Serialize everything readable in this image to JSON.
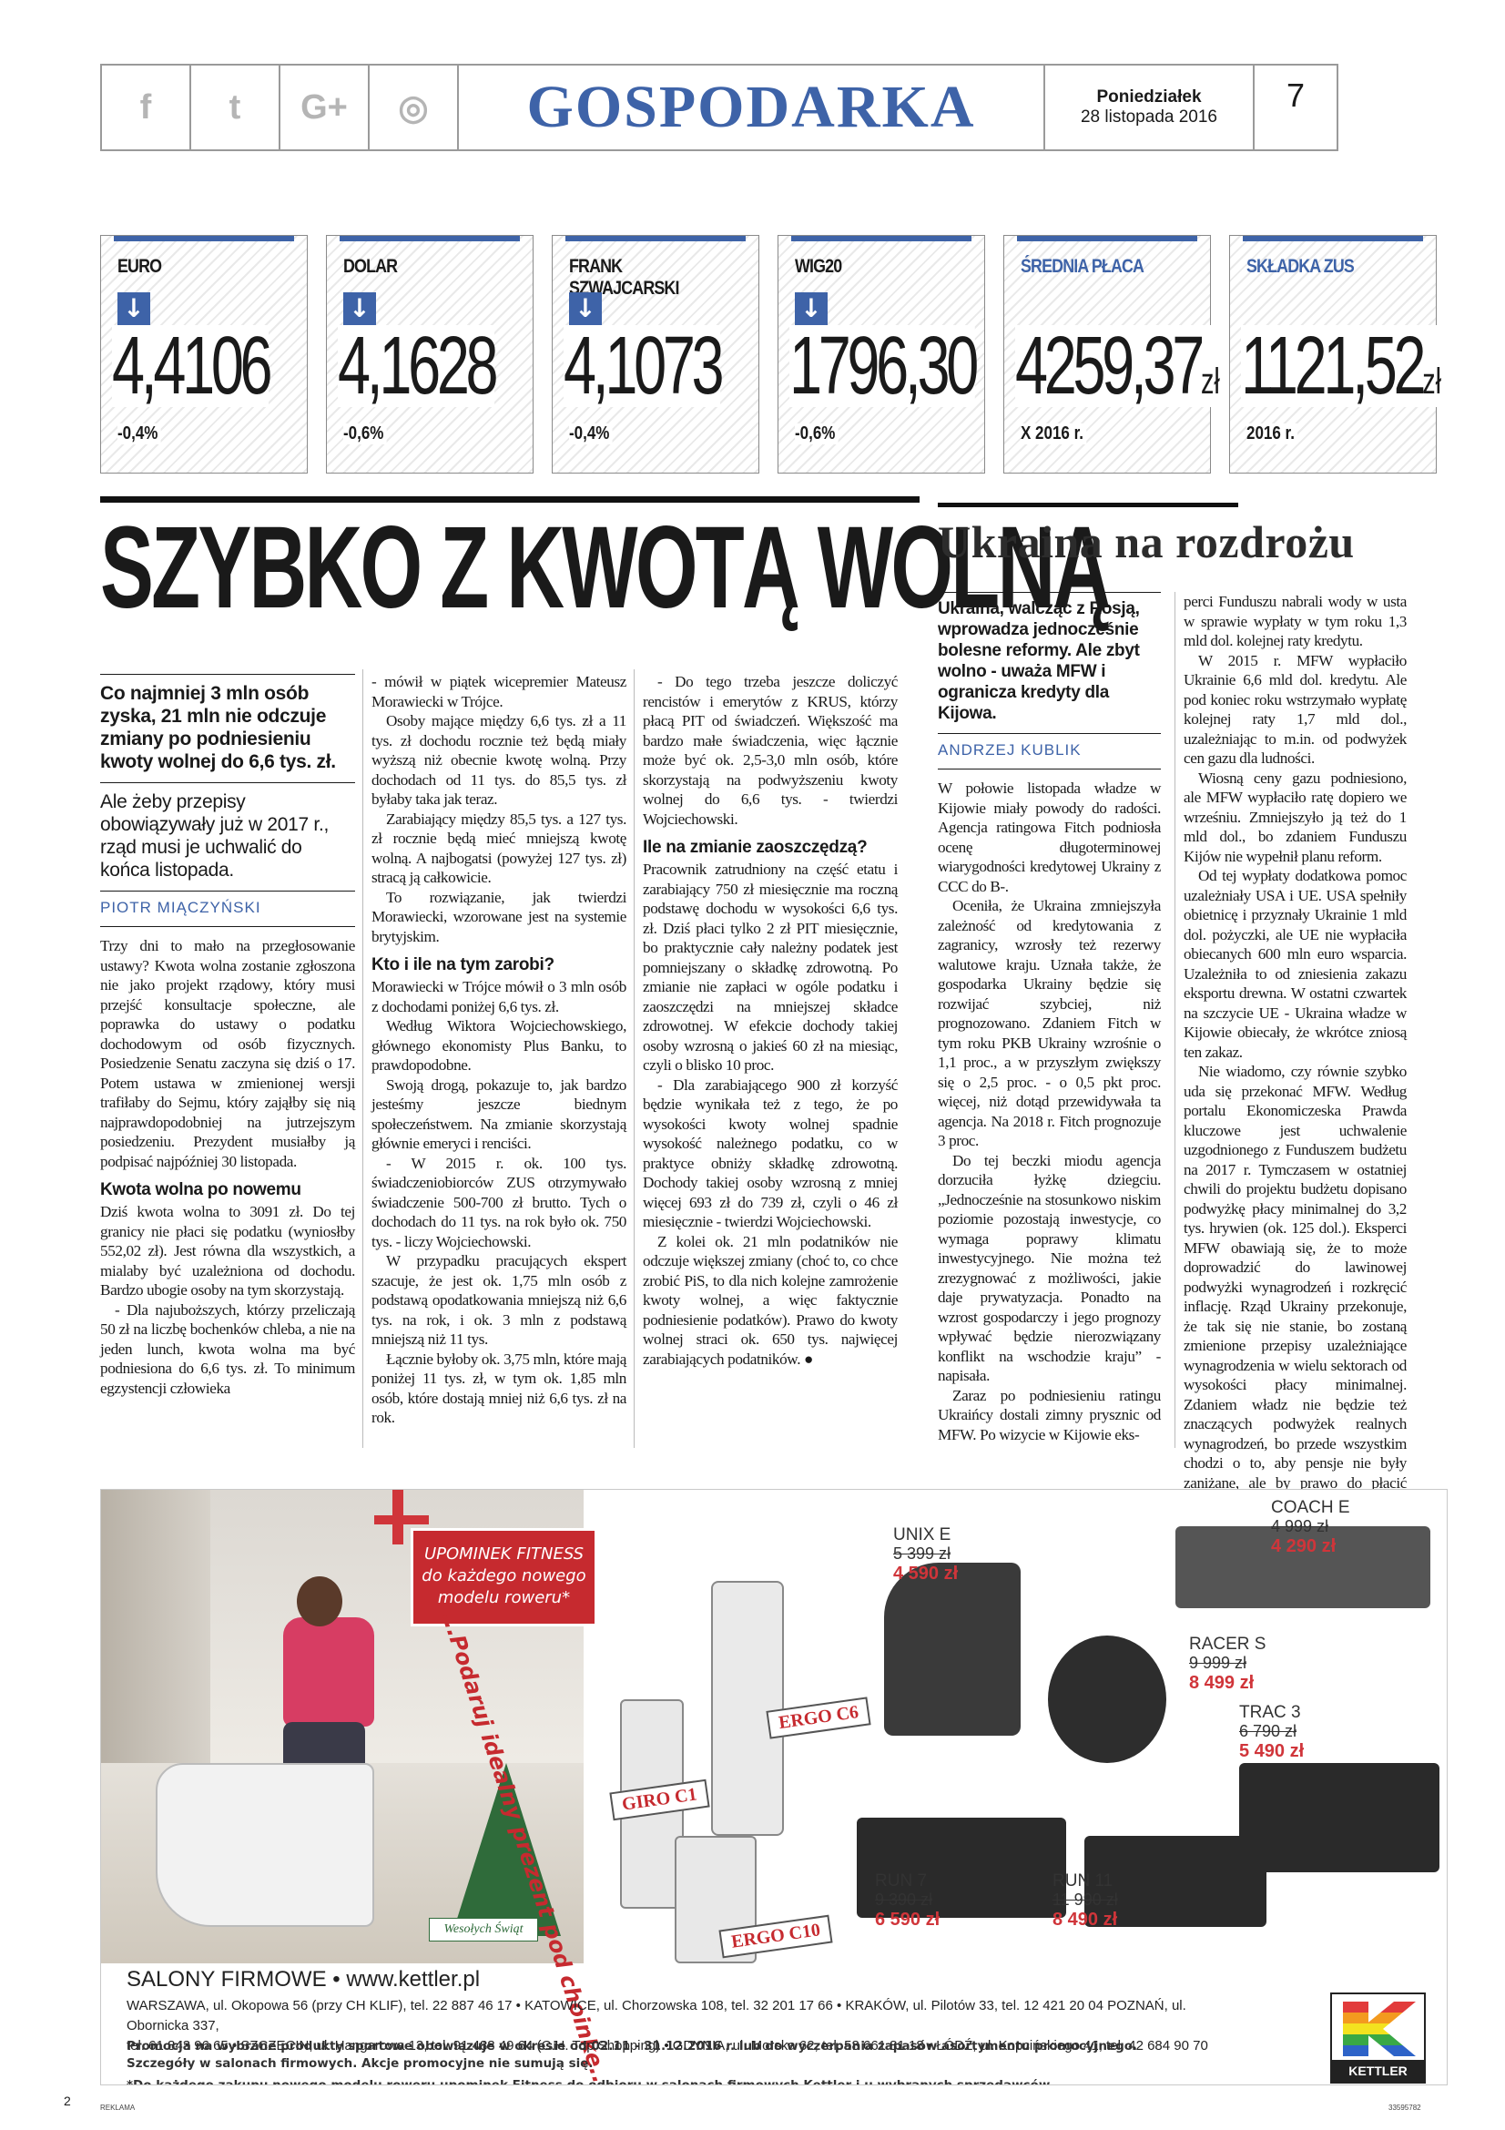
{
  "header": {
    "social": {
      "facebook": "f",
      "twitter": "t",
      "googleplus": "G+",
      "instagram": "◎"
    },
    "section": "GOSPODARKA",
    "day": "Poniedziałek",
    "date": "28 listopada 2016",
    "page": "7"
  },
  "tickers": [
    {
      "label": "EURO",
      "value": "4,4106",
      "unit": "",
      "change": "-0,4%",
      "arrow": true
    },
    {
      "label": "DOLAR",
      "value": "4,1628",
      "unit": "",
      "change": "-0,6%",
      "arrow": true
    },
    {
      "label": "FRANK SZWAJCARSKI",
      "value": "4,1073",
      "unit": "",
      "change": "-0,4%",
      "arrow": true
    },
    {
      "label": "WIG20",
      "value": "1796,30",
      "unit": "",
      "change": "-0,6%",
      "arrow": true
    },
    {
      "label": "ŚREDNIA PŁACA",
      "value": "4259,37",
      "unit": "zł",
      "change": "X 2016 r.",
      "arrow": false
    },
    {
      "label": "SKŁADKA ZUS",
      "value": "1121,52",
      "unit": "zł",
      "change": "2016 r.",
      "arrow": false
    }
  ],
  "main": {
    "headline": "SZYBKO Z KWOTĄ WOLNĄ",
    "lead1": "Co najmniej 3 mln osób zyska, 21 mln nie odczuje zmiany po podniesieniu kwoty wolnej do 6,6 tys. zł.",
    "lead2": "Ale żeby przepisy obowiązywały już w 2017 r., rząd musi je uchwalić do końca listopada.",
    "author": "PIOTR MIĄCZYŃSKI",
    "c1p1": "Trzy dni to mało na przegłosowanie ustawy? Kwota wolna zostanie zgłoszona nie jako projekt rządowy, który musi przejść konsultacje społeczne, ale poprawka do ustawy o podatku dochodowym od osób fizycznych. Posiedzenie Senatu zaczyna się dziś o 17. Potem ustawa w zmienionej wersji trafiłaby do Sejmu, który zająłby się nią najprawdopodobniej na jutrzejszym posiedzeniu. Prezydent musiałby ją podpisać najpóźniej 30 listopada.",
    "c1h1": "Kwota wolna po nowemu",
    "c1p2": "Dziś kwota wolna to 3091 zł. Do tej granicy nie płaci się podatku (wyniosłby 552,02 zł). Jest równa dla wszystkich, a mialaby być uzależniona od dochodu. Bardzo ubogie osoby na tym skorzystają.",
    "c1p3": "- Dla najuboższych, którzy przeliczają 50 zł na liczbę bochenków chleba, a nie na jeden lunch, kwota wolna ma być podniesiona do 6,6 tys. zł. To minimum egzystencji człowieka",
    "c2p1": "- mówił w piątek wicepremier Mateusz Morawiecki w Trójce.",
    "c2p2": "Osoby mające między 6,6 tys. zł a 11 tys. zł dochodu rocznie też będą miały wyższą niż obecnie kwotę wolną. Przy dochodach od 11 tys. do 85,5 tys. zł byłaby taka jak teraz.",
    "c2p3": "Zarabiający między 85,5 tys. a 127 tys. zł rocznie będą mieć mniejszą kwotę wolną. A najbogatsi (powyżej 127 tys. zł) stracą ją całkowicie.",
    "c2p4": "To rozwiązanie, jak twierdzi Morawiecki, wzorowane jest na systemie brytyjskim.",
    "c2h1": "Kto i ile na tym zarobi?",
    "c2p5": "Morawiecki w Trójce mówił o 3 mln osób z dochodami poniżej 6,6 tys. zł.",
    "c2p6": "Według Wiktora Wojciechowskiego, głównego ekonomisty Plus Banku, to prawdopodobne.",
    "c2p7": "Swoją drogą, pokazuje to, jak bardzo jesteśmy jeszcze biednym społeczeństwem. Na zmianie skorzystają głównie emeryci i renciści.",
    "c2p8": "- W 2015 r. ok. 100 tys. świadczeniobiorców ZUS otrzymywało świadczenie 500-700 zł brutto. Tych o dochodach do 11 tys. na rok było ok. 750 tys. - liczy Wojciechowski.",
    "c2p9": "W przypadku pracujących ekspert szacuje, że jest ok. 1,75 mln osób z podstawą opodatkowania mniejszą niż 6,6 tys. na rok, i ok. 3 mln z podstawą mniejszą niż 11 tys.",
    "c2p10": "Łącznie byłoby ok. 3,75 mln, które mają poniżej 11 tys. zł, w tym ok. 1,85 mln osób, które dostają mniej niż 6,6 tys. zł na rok.",
    "c3p1": "- Do tego trzeba jeszcze doliczyć rencistów i emerytów z KRUS, którzy płacą PIT od świadczeń. Większość ma bardzo małe świadczenia, więc łącznie może być ok. 2,5-3,0 mln osób, które skorzystają na podwyższeniu kwoty wolnej do 6,6 tys. - twierdzi Wojciechowski.",
    "c3h1": "Ile na zmianie zaoszczędzą?",
    "c3p2": "Pracownik zatrudniony na część etatu i zarabiający 750 zł miesięcznie ma roczną podstawę dochodu w wysokości 6,6 tys. zł. Dziś płaci tylko 2 zł PIT miesięcznie, bo praktycznie cały należny podatek jest pomniejszany o składkę zdrowotną. Po zmianie nie zapłaci w ogóle podatku i zaoszczędzi na mniejszej składce zdrowotnej. W efekcie dochody takiej osoby wzrosną o jakieś 60 zł na miesiąc, czyli o blisko 10 proc.",
    "c3p3": "- Dla zarabiającego 900 zł korzyść będzie wynikała też z tego, że po wysokości kwoty wolnej spadnie wysokość należnego podatku, co w praktyce obniży składkę zdrowotną. Dochody takiej osoby wzrosną z mniej więcej 693 zł do 739 zł, czyli o 46 zł miesięcznie - twierdzi Wojciechowski.",
    "c3p4": "Z kolei ok. 21 mln podatników nie odczuje większej zmiany (choć to, co chce zrobić PiS, to dla nich kolejne zamrożenie kwoty wolnej, a więc faktycznie podniesienie podatków). Prawo do kwoty wolnej straci ok. 650 tys. najwięcej zarabiających podatników. ●"
  },
  "side": {
    "headline": "Ukraina na rozdrożu",
    "lead": "Ukraina, walcząc z Rosją, wprowadza jednocześnie bolesne reformy. Ale zbyt wolno - uważa MFW i ogranicza kredyty dla Kijowa.",
    "author": "ANDRZEJ KUBLIK",
    "c1p1": "W połowie listopada władze w Kijowie miały powody do radości. Agencja ratingowa Fitch podniosła ocenę długoterminowej wiarygodności kredytowej Ukrainy z CCC do B-.",
    "c1p2": "Oceniła, że Ukraina zmniejszyła zależność od kredytowania z zagranicy, wzrosły też rezerwy walutowe kraju. Uznała także, że gospodarka Ukrainy będzie się rozwijać szybciej, niż prognozowano. Zdaniem Fitch w tym roku PKB Ukrainy wzrośnie o 1,1 proc., a w przyszłym zwiększy się o 2,5 proc. - o 0,5 pkt proc. więcej, niż dotąd przewidywała ta agencja. Na 2018 r. Fitch prognozuje 3 proc.",
    "c1p3": "Do tej beczki miodu agencja dorzuciła łyżkę dziegciu. „Jednocześnie na stosunkowo niskim poziomie pozostają inwestycje, co wymaga poprawy klimatu inwestycyjnego. Nie można też zrezygnować z możliwości, jakie daje prywatyzacja. Ponadto na wzrost gospodarczy i jego prognozy wpływać będzie nierozwiązany konflikt na wschodzie kraju” - napisała.",
    "c1p4": "Zaraz po podniesieniu ratingu Ukraińcy dostali zimny prysznic od MFW. Po wizycie w Kijowie eks-",
    "c2p1": "perci Funduszu nabrali wody w usta w sprawie wypłaty w tym roku 1,3 mld dol. kolejnej raty kredytu.",
    "c2p2": "W 2015 r. MFW wypłaciło Ukrainie 6,6 mld dol. kredytu. Ale pod koniec roku wstrzymało wypłatę kolejnej raty 1,7 mld dol., uzależniając to m.in. od podwyżek cen gazu dla ludności.",
    "c2p3": "Wiosną ceny gazu podniesiono, ale MFW wypłaciło ratę dopiero we wrześniu. Zmniejszyło ją też do 1 mld dol., bo zdaniem Funduszu Kijów nie wypełnił planu reform.",
    "c2p4": "Od tej wypłaty dodatkowa pomoc uzależniały USA i UE. USA spełniły obietnicę i przyznały Ukrainie 1 mld dol. pożyczki, ale UE nie wypłaciła obiecanych 600 mln euro wsparcia. Uzależniła to od zniesienia zakazu eksportu drewna. W ostatni czwartek na szczycie UE - Ukraina władze w Kijowie obiecały, że wkrótce zniosą ten zakaz.",
    "c2p5": "Nie wiadomo, czy równie szybko uda się przekonać MFW. Według portalu Ekonomiczeska Prawda kluczowe jest uchwalenie uzgodnionego z Funduszem budżetu na 2017 r. Tymczasem w ostatniej chwili do projektu budżetu dopisano podwyżkę płacy minimalnej do 3,2 tys. hrywien (ok. 125 dol.). Eksperci MFW obawiają się, że to może doprowadzić do lawinowej podwyżki wynagrodzeń i rozkręcić inflację. Rząd Ukrainy przekonuje, że tak się nie stanie, bo zostaną zmienione przepisy uzależniające wynagrodzenia w wielu sektorach od wysokości płacy minimalnej. Zdaniem władz nie będzie też znaczących podwyżek realnych wynagrodzeń, bo przede wszystkim chodzi o to, aby pensje nie były zaniżane, ale by prawo do płacić oficjalnie część pensji wypłacanych dotąd pod stołem. ●"
  },
  "ad": {
    "promo_title": "UPOMINEK FITNESS",
    "promo_sub1": "do każdego nowego",
    "promo_sub2": "modelu roweru*",
    "arc_text": "...Podaruj idealny prezent pod choinkę...",
    "greeting": "Wesołych Świąt",
    "tags": {
      "giro": "GIRO C1",
      "ergo6": "ERGO C6",
      "ergo10": "ERGO C10"
    },
    "products": [
      {
        "name": "UNIX E",
        "old": "5 399 zł",
        "new": "4 590 zł"
      },
      {
        "name": "COACH E",
        "old": "4 999 zł",
        "new": "4 290 zł"
      },
      {
        "name": "RACER S",
        "old": "9 999 zł",
        "new": "8 499 zł"
      },
      {
        "name": "TRAC 3",
        "old": "6 790 zł",
        "new": "5 490 zł"
      },
      {
        "name": "RUN 7",
        "old": "9 390 zł",
        "new": "6 590 zł"
      },
      {
        "name": "RUN 11",
        "old": "11 990 zł",
        "new": "8 490 zł"
      }
    ],
    "salony": "SALONY FIRMOWE • www.kettler.pl",
    "addr_line1": "WARSZAWA, ul. Okopowa 56 (przy CH KLIF), tel. 22 887 46 17 • KATOWICE, ul. Chorzowska 108, tel. 32 201 17 66 • KRAKÓW, ul. Pilotów 33, tel. 12 421 20 04 POZNAŃ, ul. Obornicka 337,",
    "addr_line2": "tel. 61 843 96 65 • SZCZECIN, ul. Hangarowa 13, tel. 91 488 49 64 (C.H. Top Shopping) • GDYNIA, ul. Morska 62, tel. 58 661 81 18 • ŁÓDŹ, ul. Kopcińskiego 41, tel. 42 684 90 70",
    "fine1": "Promocja na wybrane produkty sportowe obowiązuje w okresie od 02.11 - 31.12.2016 r. lub do wyczerpania zapasów asortymentu promocyjnego.",
    "fine1b": "Szczegóły w salonach firmowych. Akcje promocyjne nie sumują się.",
    "fine2": "*Do każdego zakupu nowego modelu roweru upominek Fitness do odbioru w salonach firmowych Kettler i u wybranych sprzedawców.",
    "logo": "KETTLER"
  },
  "footer": {
    "left": "2",
    "tag": "REKLAMA",
    "code": "33595782"
  }
}
